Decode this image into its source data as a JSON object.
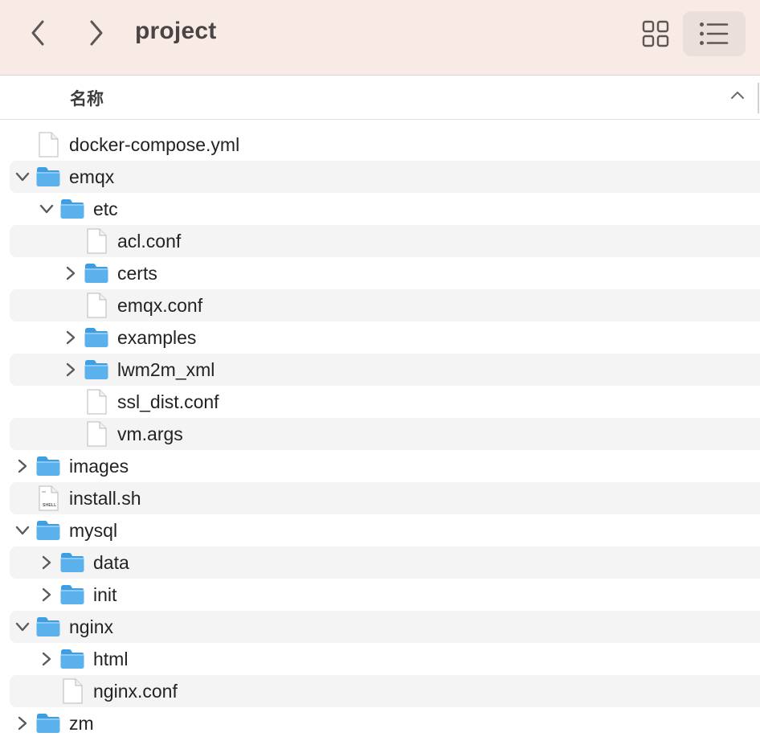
{
  "toolbar": {
    "title": "project",
    "back_icon": "chevron-left-icon",
    "forward_icon": "chevron-right-icon",
    "grid_view_icon": "grid-view-icon",
    "list_view_icon": "list-view-icon",
    "active_view": "list"
  },
  "header": {
    "name_column": "名称",
    "sort_icon": "chevron-up-icon"
  },
  "colors": {
    "toolbar_bg": "#f8ebe6",
    "folder_blue": "#5ab1ec",
    "row_alt": "#f4f4f4"
  },
  "items": [
    {
      "name": "docker-compose.yml",
      "type": "file",
      "depth": 0,
      "expanded": null
    },
    {
      "name": "emqx",
      "type": "folder",
      "depth": 0,
      "expanded": true
    },
    {
      "name": "etc",
      "type": "folder",
      "depth": 1,
      "expanded": true
    },
    {
      "name": "acl.conf",
      "type": "file",
      "depth": 2,
      "expanded": null
    },
    {
      "name": "certs",
      "type": "folder",
      "depth": 2,
      "expanded": false
    },
    {
      "name": "emqx.conf",
      "type": "file",
      "depth": 2,
      "expanded": null
    },
    {
      "name": "examples",
      "type": "folder",
      "depth": 2,
      "expanded": false
    },
    {
      "name": "lwm2m_xml",
      "type": "folder",
      "depth": 2,
      "expanded": false
    },
    {
      "name": "ssl_dist.conf",
      "type": "file",
      "depth": 2,
      "expanded": null
    },
    {
      "name": "vm.args",
      "type": "file",
      "depth": 2,
      "expanded": null
    },
    {
      "name": "images",
      "type": "folder",
      "depth": 0,
      "expanded": false
    },
    {
      "name": "install.sh",
      "type": "shell",
      "depth": 0,
      "expanded": null,
      "icon_label": "SHELL"
    },
    {
      "name": "mysql",
      "type": "folder",
      "depth": 0,
      "expanded": true
    },
    {
      "name": "data",
      "type": "folder",
      "depth": 1,
      "expanded": false
    },
    {
      "name": "init",
      "type": "folder",
      "depth": 1,
      "expanded": false
    },
    {
      "name": "nginx",
      "type": "folder",
      "depth": 0,
      "expanded": true
    },
    {
      "name": "html",
      "type": "folder",
      "depth": 1,
      "expanded": false
    },
    {
      "name": "nginx.conf",
      "type": "file",
      "depth": 1,
      "expanded": null
    },
    {
      "name": "zm",
      "type": "folder",
      "depth": 0,
      "expanded": false
    }
  ]
}
